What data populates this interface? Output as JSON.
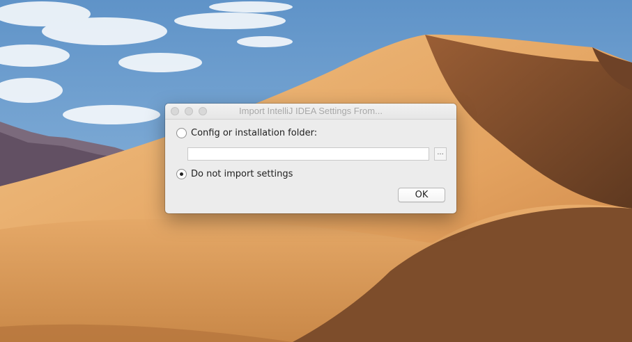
{
  "dialog": {
    "title": "Import IntelliJ IDEA Settings From...",
    "option_config_label": "Config or installation folder:",
    "option_config_selected": false,
    "path_value": "",
    "browse_label": "...",
    "option_none_label": "Do not import settings",
    "option_none_selected": true,
    "ok_label": "OK"
  },
  "colors": {
    "sky": "#6f9fcf",
    "sand_light": "#e9b574",
    "sand_shadow": "#7a4c2d",
    "dialog_bg": "#ececec"
  }
}
